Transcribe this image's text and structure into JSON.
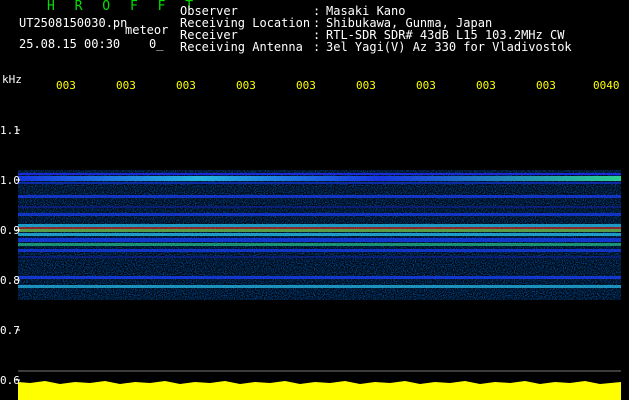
{
  "header": {
    "brand": "H R O F F T",
    "filename": "UT2508150030.pn",
    "meteor": "meteor",
    "date": "25.08.15 00:30    0_",
    "fields": [
      {
        "label": "Observer",
        "value": "Masaki Kano"
      },
      {
        "label": "Receiving Location",
        "value": "Shibukawa, Gunma, Japan"
      },
      {
        "label": "Receiver",
        "value": "RTL-SDR SDR# 43dB L15 103.2MHz CW"
      },
      {
        "label": "Receiving Antenna",
        "value": "3el Yagi(V) Az 330 for Vladivostok"
      }
    ]
  },
  "axis": {
    "y_unit": "kHz",
    "y_labels": [
      "1.1",
      "1.0",
      "0.9",
      "0.8",
      "0.7",
      "0.6"
    ],
    "x_ticks": [
      "003",
      "003",
      "003",
      "003",
      "003",
      "003",
      "003",
      "003",
      "003",
      "0040"
    ]
  },
  "colors": {
    "background": "#000000",
    "brand": "#00e000",
    "text": "#ffffff",
    "ticks": "#ffff00",
    "trace": "#ffff00"
  }
}
